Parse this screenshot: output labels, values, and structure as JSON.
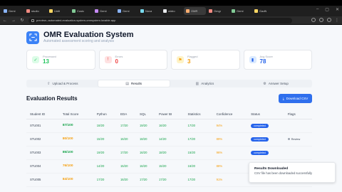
{
  "browser": {
    "tabs": [
      {
        "label": "Gemi",
        "color": "#8ab4f8"
      },
      {
        "label": "studio",
        "color": "#f28b82"
      },
      {
        "label": "Untit",
        "color": "#fdd663"
      },
      {
        "label": "Custo",
        "color": "#81c995"
      },
      {
        "label": "Gemi",
        "color": "#c58af9"
      },
      {
        "label": "Gemi",
        "color": "#8ab4f8"
      },
      {
        "label": "Nova",
        "color": "#78d9ec"
      },
      {
        "label": "widro",
        "color": "#e8eaed"
      },
      {
        "label": "OMR",
        "color": "#fcad70"
      },
      {
        "label": "Omgr",
        "color": "#f28b82"
      },
      {
        "label": "Gemi",
        "color": "#81c995"
      },
      {
        "label": "GadN",
        "color": "#fdd663"
      }
    ],
    "active_tab_index": 8,
    "url": "preview--automated-evaluation-system-omrsystem.lovable.app"
  },
  "app": {
    "title": "OMR Evaluation System",
    "subtitle": "Automated assessment scoring and analysis"
  },
  "stats": [
    {
      "label": "Processed",
      "value": "13",
      "color": "#22c55e",
      "bg": "#dcfce7",
      "icon": "check-icon",
      "glyph": "✓"
    },
    {
      "label": "Errors",
      "value": "0",
      "color": "#ef4444",
      "bg": "#fee2e2",
      "icon": "alert-icon",
      "glyph": "!"
    },
    {
      "label": "Flagged",
      "value": "3",
      "color": "#f59e0b",
      "bg": "#fef3c7",
      "icon": "flag-icon",
      "glyph": "⚑"
    },
    {
      "label": "Avg Score",
      "value": "78",
      "color": "#2563eb",
      "bg": "#dbeafe",
      "icon": "chart-icon",
      "glyph": "▮"
    }
  ],
  "tabs": [
    {
      "label": "Upload & Process",
      "icon": "upload-icon",
      "glyph": "⇧",
      "active": false
    },
    {
      "label": "Results",
      "icon": "document-icon",
      "glyph": "▤",
      "active": true
    },
    {
      "label": "Analytics",
      "icon": "analytics-icon",
      "glyph": "▥",
      "active": false
    },
    {
      "label": "Answer Setup",
      "icon": "settings-icon",
      "glyph": "⚙",
      "active": false
    }
  ],
  "results": {
    "title": "Evaluation Results",
    "download_label": "Download CSV",
    "columns": [
      "Student ID",
      "Total Score",
      "Python",
      "EDA",
      "SQL",
      "Power BI",
      "Statistics",
      "Confidence",
      "Status",
      "Flags"
    ],
    "rows": [
      {
        "id": "STU001",
        "total": "87/100",
        "tone": "grn",
        "python": "18/20",
        "eda": "17/20",
        "sql": "19/20",
        "powerbi": "16/20",
        "stats": "17/20",
        "conf": "94%",
        "status": "completed",
        "flag": ""
      },
      {
        "id": "STU002",
        "total": "80/100",
        "tone": "org",
        "python": "15/20",
        "eda": "16/20",
        "sql": "18/20",
        "powerbi": "14/20",
        "stats": "17/20",
        "conf": "89%",
        "status": "completed",
        "flag": "Review"
      },
      {
        "id": "STU003",
        "total": "85/100",
        "tone": "grn",
        "python": "19/20",
        "eda": "17/20",
        "sql": "16/20",
        "powerbi": "18/20",
        "stats": "15/20",
        "conf": "96%",
        "status": "completed",
        "flag": ""
      },
      {
        "id": "STU004",
        "total": "76/100",
        "tone": "org",
        "python": "14/20",
        "eda": "15/20",
        "sql": "16/20",
        "powerbi": "15/20",
        "stats": "16/20",
        "conf": "88%",
        "status": "completed",
        "flag": ""
      },
      {
        "id": "STU005",
        "total": "84/100",
        "tone": "org",
        "python": "17/20",
        "eda": "16/20",
        "sql": "17/20",
        "powerbi": "17/20",
        "stats": "17/20",
        "conf": "91%",
        "status": "completed",
        "flag": ""
      }
    ]
  },
  "toast": {
    "title": "Results Downloaded",
    "message": "CSV file has been downloaded successfully"
  }
}
